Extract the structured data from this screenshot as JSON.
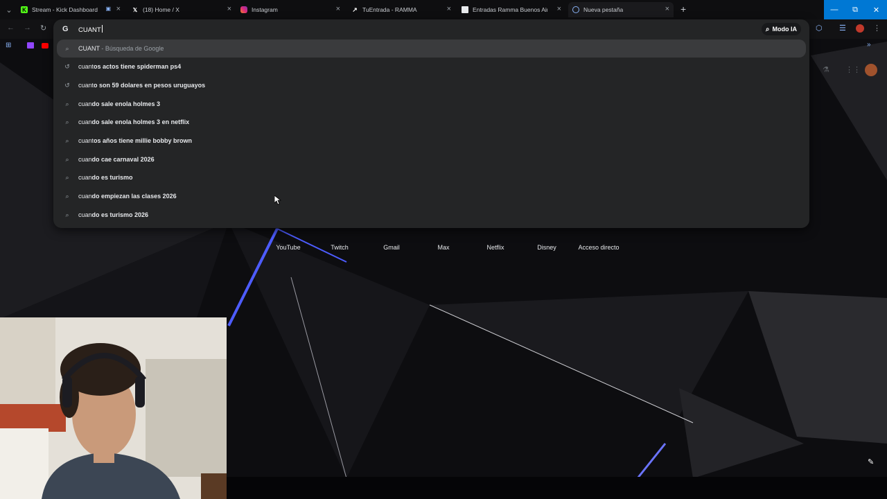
{
  "tabs": [
    {
      "title": "Stream - Kick Dashboard",
      "favicon": "kick-icon",
      "color": "#53fc18"
    },
    {
      "title": "(18) Home / X",
      "favicon": "x-icon",
      "color": "#ffffff"
    },
    {
      "title": "Instagram",
      "favicon": "instagram-icon",
      "color": "#e1306c"
    },
    {
      "title": "TuEntrada - RAMMA",
      "favicon": "tuentrada-icon",
      "color": "#ffffff"
    },
    {
      "title": "Entradas Ramma Buenos Aires",
      "favicon": "ramma-icon",
      "color": "#e8eaed"
    },
    {
      "title": "Nueva pestaña",
      "favicon": "chrome-icon",
      "color": "#8ab4f8"
    }
  ],
  "omnibox": {
    "value": "CUANT",
    "modo_ia_label": "Modo IA"
  },
  "suggestions": [
    {
      "typed": "CUANT",
      "rest": "",
      "sub": " - Búsqueda de Google",
      "icon": "search-icon"
    },
    {
      "typed": "cuant",
      "rest": "os actos tiene spiderman ps4",
      "icon": "history-icon"
    },
    {
      "typed": "cuant",
      "rest": "o son 59 dolares en pesos uruguayos",
      "icon": "history-icon"
    },
    {
      "typed": "cuan",
      "rest": "do sale enola holmes 3",
      "icon": "search-icon"
    },
    {
      "typed": "cuan",
      "rest": "do sale enola holmes 3 en netflix",
      "icon": "search-icon"
    },
    {
      "typed": "cuant",
      "rest": "os años tiene millie bobby brown",
      "icon": "search-icon"
    },
    {
      "typed": "cuan",
      "rest": "do cae carnaval 2026",
      "icon": "search-icon"
    },
    {
      "typed": "cuan",
      "rest": "do es turismo",
      "icon": "search-icon"
    },
    {
      "typed": "cuan",
      "rest": "do empiezan las clases 2026",
      "icon": "search-icon"
    },
    {
      "typed": "cuan",
      "rest": "do es turismo 2026",
      "icon": "search-icon"
    }
  ],
  "shortcuts": [
    {
      "label": "YouTube"
    },
    {
      "label": "Twitch"
    },
    {
      "label": "Gmail"
    },
    {
      "label": "Max"
    },
    {
      "label": "Netflix"
    },
    {
      "label": "Disney"
    },
    {
      "label": "Acceso directo"
    }
  ],
  "colors": {
    "accent": "#4d5cff",
    "omnibox_bg": "#242526",
    "highlight": "#3a3b3d"
  }
}
